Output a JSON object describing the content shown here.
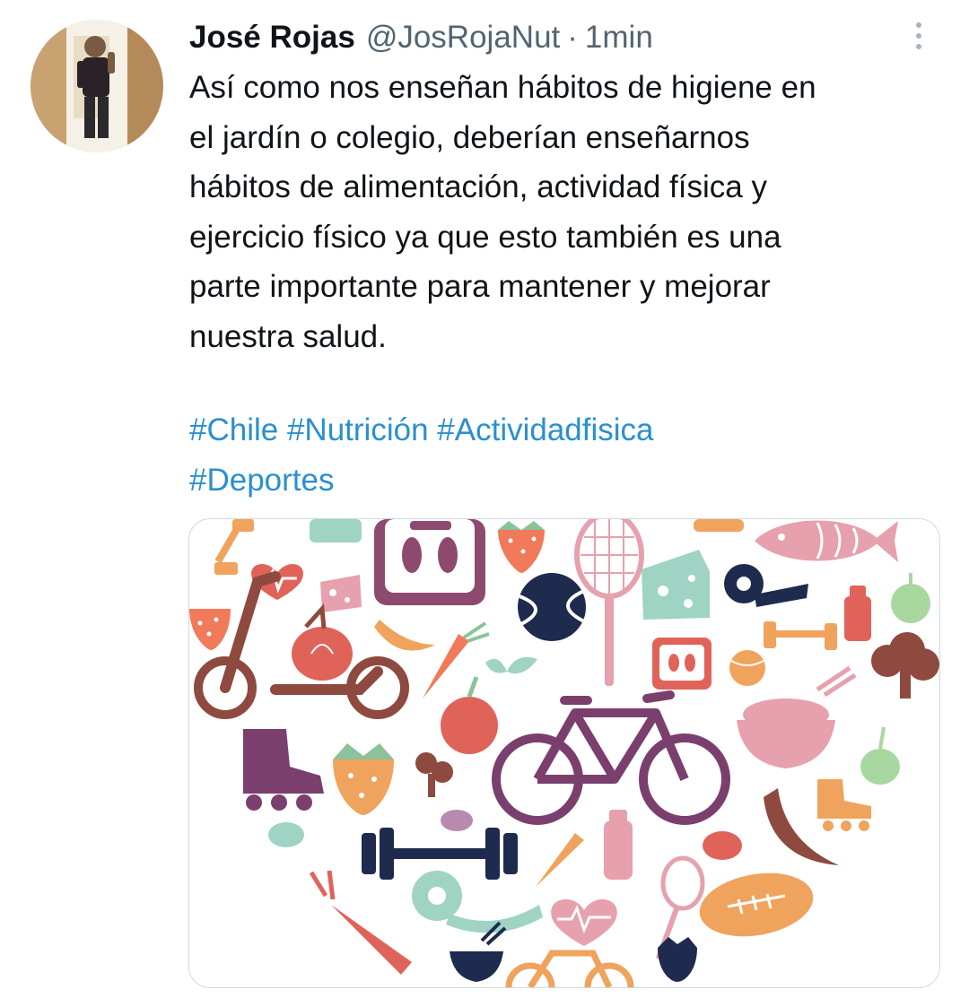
{
  "tweet": {
    "author": {
      "name": "José Rojas",
      "handle": "@JosRojaNut"
    },
    "separator": "·",
    "time": "1min",
    "text": "Así como nos enseñan hábitos de higiene en\nel jardín o colegio, deberían enseñarnos\nhábitos de alimentación, actividad física y\nejercicio físico ya que esto también es una\nparte importante para mantener y mejorar\nnuestra salud.",
    "hashtags": [
      "#Chile",
      "#Nutrición",
      "#Actividadfisica",
      "#Deportes"
    ],
    "media": {
      "icons": [
        "dumbbell-icon",
        "heart-icon",
        "scale-icon",
        "strawberry-icon",
        "tennis-racket-icon",
        "fish-icon",
        "cheese-icon",
        "tennis-ball-icon",
        "measuring-tape-icon",
        "water-bottle-icon",
        "apple-icon",
        "scooter-icon",
        "onion-icon",
        "banana-icon",
        "carrot-icon",
        "broccoli-icon",
        "bicycle-icon",
        "bowl-icon",
        "inline-skate-icon",
        "bottle-icon",
        "football-icon"
      ]
    }
  },
  "colors": {
    "text": "#0f1419",
    "secondary": "#536471",
    "link": "#2a8fd0",
    "border": "#cfd9de",
    "purple": "#7b3f6e",
    "navy": "#1f2a4f",
    "coral": "#e0635a",
    "brown": "#8e4a3f",
    "mint": "#9fd3c3",
    "orange": "#f0a35c",
    "pink": "#e7a0ad"
  }
}
